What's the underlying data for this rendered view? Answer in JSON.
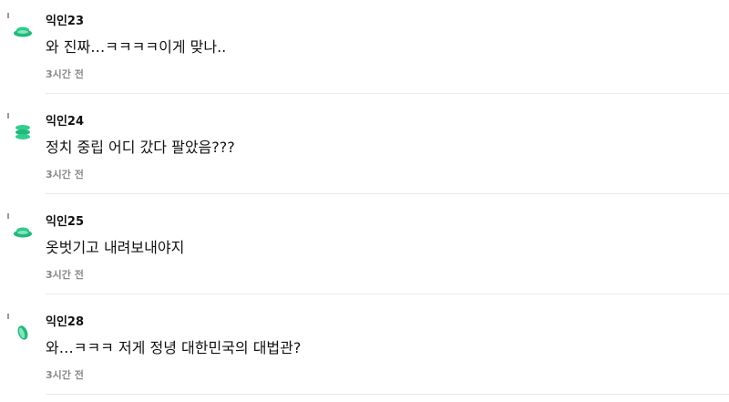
{
  "comments": [
    {
      "nickname": "익인23",
      "content": "와 진짜…ㅋㅋㅋㅋ이게 맞나..",
      "time": "3시간 전",
      "avatar_icon": "green-ufo-icon",
      "avatar_color": "#2fcf8f"
    },
    {
      "nickname": "익인24",
      "content": "정치 중립 어디 갔다 팔았음???",
      "time": "3시간 전",
      "avatar_icon": "green-stack-icon",
      "avatar_color": "#2fcf8f"
    },
    {
      "nickname": "익인25",
      "content": "옷벗기고 내려보내야지",
      "time": "3시간 전",
      "avatar_icon": "green-ufo-icon",
      "avatar_color": "#2fcf8f"
    },
    {
      "nickname": "익인28",
      "content": "와…ㅋㅋㅋ 저게 정녕 대한민국의 대법관?",
      "time": "3시간 전",
      "avatar_icon": "green-leaf-icon",
      "avatar_color": "#2fcf8f"
    }
  ]
}
